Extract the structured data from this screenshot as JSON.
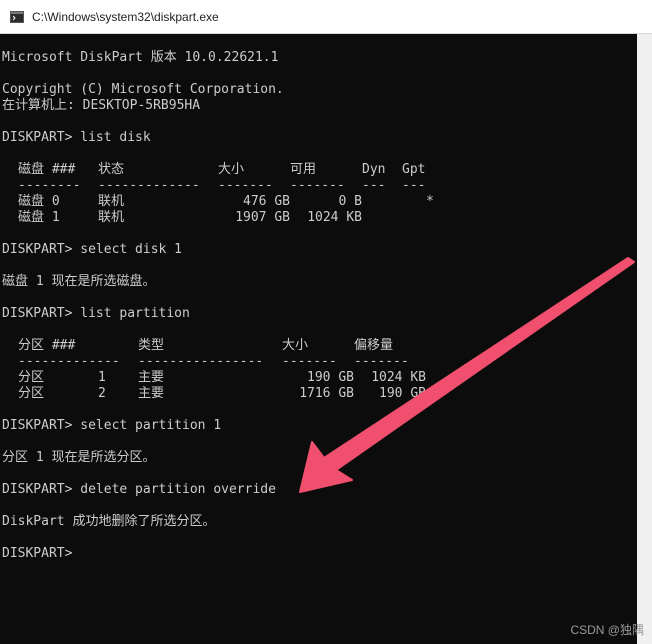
{
  "window": {
    "title": "C:\\Windows\\system32\\diskpart.exe",
    "icon": "console-icon"
  },
  "console": {
    "lines": {
      "version": "Microsoft DiskPart 版本 10.0.22621.1",
      "copyright": "Copyright (C) Microsoft Corporation.",
      "computer": "在计算机上: DESKTOP-5RB95HA",
      "cmd_list_disk": "DISKPART> list disk",
      "cmd_select_disk": "DISKPART> select disk 1",
      "select_disk_result": "磁盘 1 现在是所选磁盘。",
      "cmd_list_partition": "DISKPART> list partition",
      "cmd_select_partition": "DISKPART> select partition 1",
      "select_partition_result": "分区 1 现在是所选分区。",
      "cmd_delete_partition": "DISKPART> delete partition override",
      "delete_result": "DiskPart 成功地删除了所选分区。",
      "prompt": "DISKPART>"
    },
    "disk_table": {
      "headers": [
        "磁盘 ###",
        "状态",
        "大小",
        "可用",
        "Dyn",
        "Gpt"
      ],
      "separators": [
        "--------",
        "-------------",
        "-------",
        "-------",
        "---",
        "---"
      ],
      "rows": [
        {
          "disk": "磁盘 0",
          "status": "联机",
          "size": "476 GB",
          "free": "0 B",
          "dyn": "",
          "gpt": "*"
        },
        {
          "disk": "磁盘 1",
          "status": "联机",
          "size": "1907 GB",
          "free": "1024 KB",
          "dyn": "",
          "gpt": ""
        }
      ]
    },
    "partition_table": {
      "headers": [
        "分区 ###",
        "类型",
        "大小",
        "偏移量"
      ],
      "separators": [
        "-------------",
        "----------------",
        "-------",
        "-------"
      ],
      "rows": [
        {
          "name": "分区",
          "num": "1",
          "type": "主要",
          "size": "190 GB",
          "offset": "1024 KB"
        },
        {
          "name": "分区",
          "num": "2",
          "type": "主要",
          "size": "1716 GB",
          "offset": "190 GB"
        }
      ]
    }
  },
  "annotation": {
    "arrow_color": "#f0506e",
    "arrow_target": "delete partition override"
  },
  "watermark": "CSDN @独隅"
}
